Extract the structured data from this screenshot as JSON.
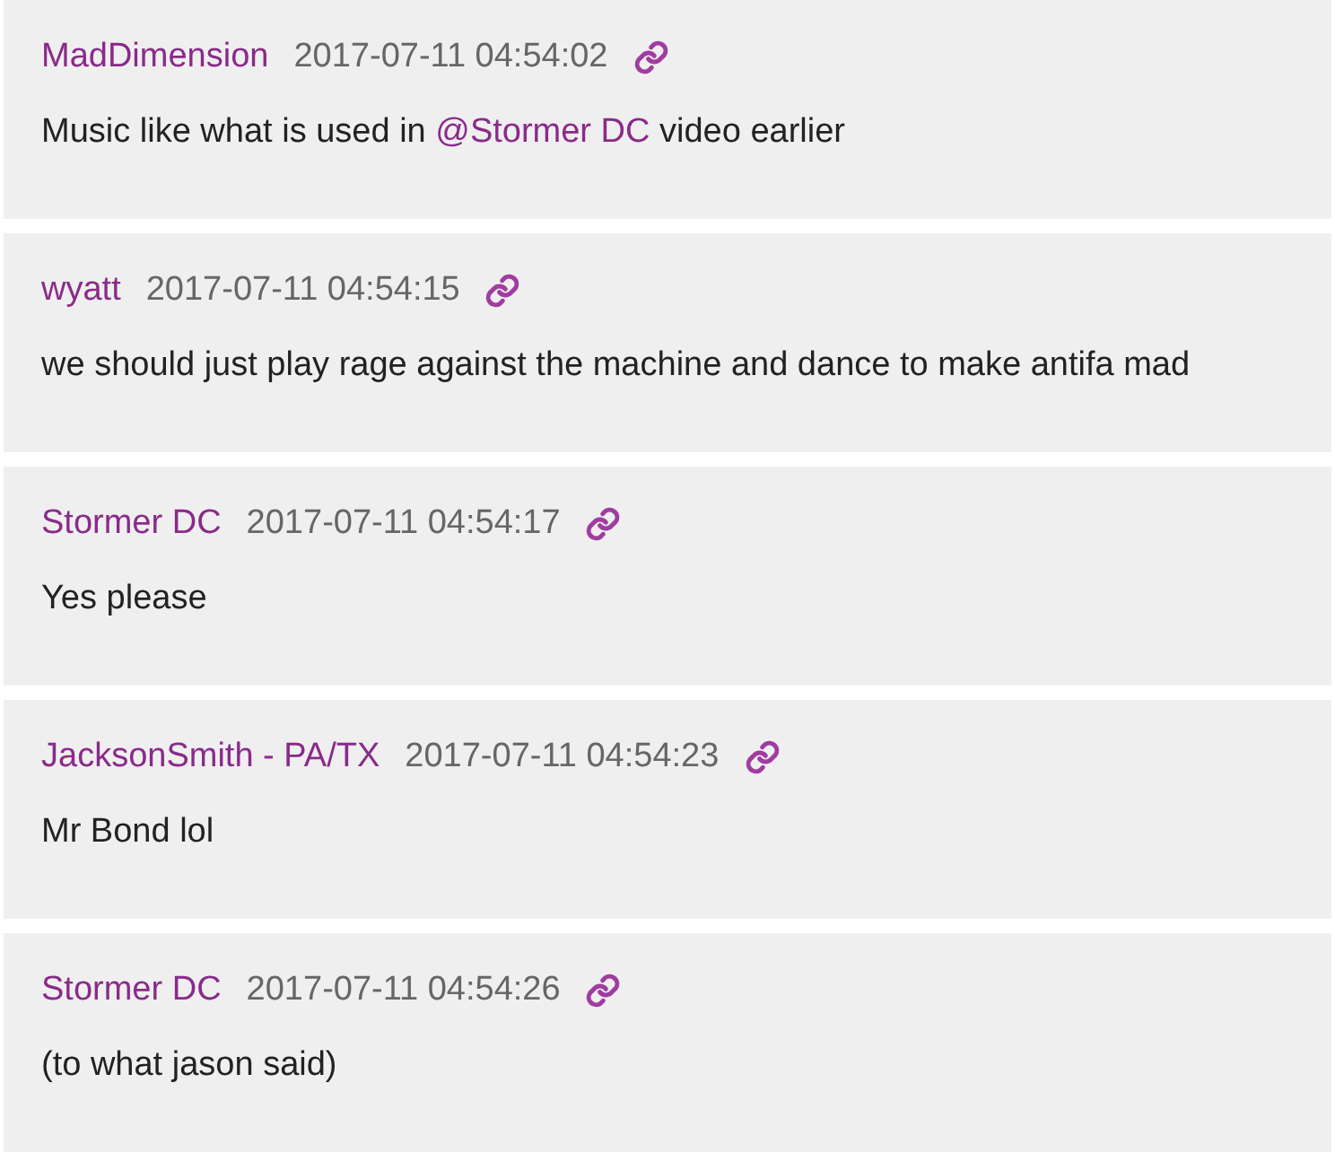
{
  "messages": [
    {
      "author": "MadDimension",
      "time": "2017-07-11 04:54:02",
      "parts": [
        {
          "kind": "text",
          "text": "Music like what is used in "
        },
        {
          "kind": "mention",
          "text": "@Stormer DC"
        },
        {
          "kind": "text",
          "text": " video earlier"
        }
      ]
    },
    {
      "author": "wyatt",
      "time": "2017-07-11 04:54:15",
      "parts": [
        {
          "kind": "text",
          "text": "we should just play rage against the machine and dance to make antifa mad"
        }
      ]
    },
    {
      "author": "Stormer DC",
      "time": "2017-07-11 04:54:17",
      "parts": [
        {
          "kind": "text",
          "text": "Yes please"
        }
      ]
    },
    {
      "author": "JacksonSmith - PA/TX",
      "time": "2017-07-11 04:54:23",
      "parts": [
        {
          "kind": "text",
          "text": "Mr Bond lol"
        }
      ]
    },
    {
      "author": "Stormer DC",
      "time": "2017-07-11 04:54:26",
      "parts": [
        {
          "kind": "text",
          "text": "(to what jason said)"
        }
      ]
    }
  ]
}
